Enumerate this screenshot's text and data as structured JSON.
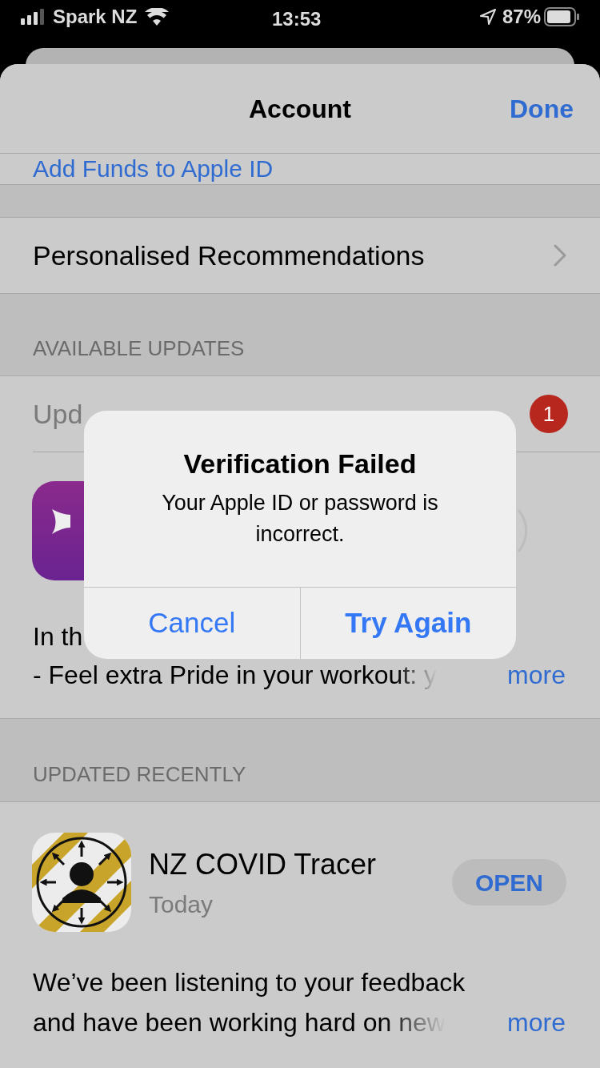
{
  "status_bar": {
    "carrier": "Spark NZ",
    "time": "13:53",
    "battery": "87%"
  },
  "nav": {
    "title": "Account",
    "done": "Done"
  },
  "add_funds_link": "Add Funds to Apple ID",
  "recommendations": "Personalised Recommendations",
  "available_updates": {
    "header": "AVAILABLE UPDATES",
    "update_all": "Upd",
    "badge": "1",
    "notes_lines": [
      "In th",
      "- Feel extra Pride in your workout: y"
    ],
    "more": "more"
  },
  "updated_recently": {
    "header": "UPDATED RECENTLY",
    "app_name": "NZ COVID Tracer",
    "date": "Today",
    "button": "OPEN",
    "notes_lines": [
      "We’ve been listening to your feedback",
      "and have been working hard on new"
    ],
    "more": "more"
  },
  "alert": {
    "title": "Verification Failed",
    "message": "Your Apple ID or password is incorrect.",
    "buttons": [
      {
        "label": "Cancel",
        "kind": "cancel"
      },
      {
        "label": "Try Again",
        "kind": "preferred"
      }
    ]
  }
}
